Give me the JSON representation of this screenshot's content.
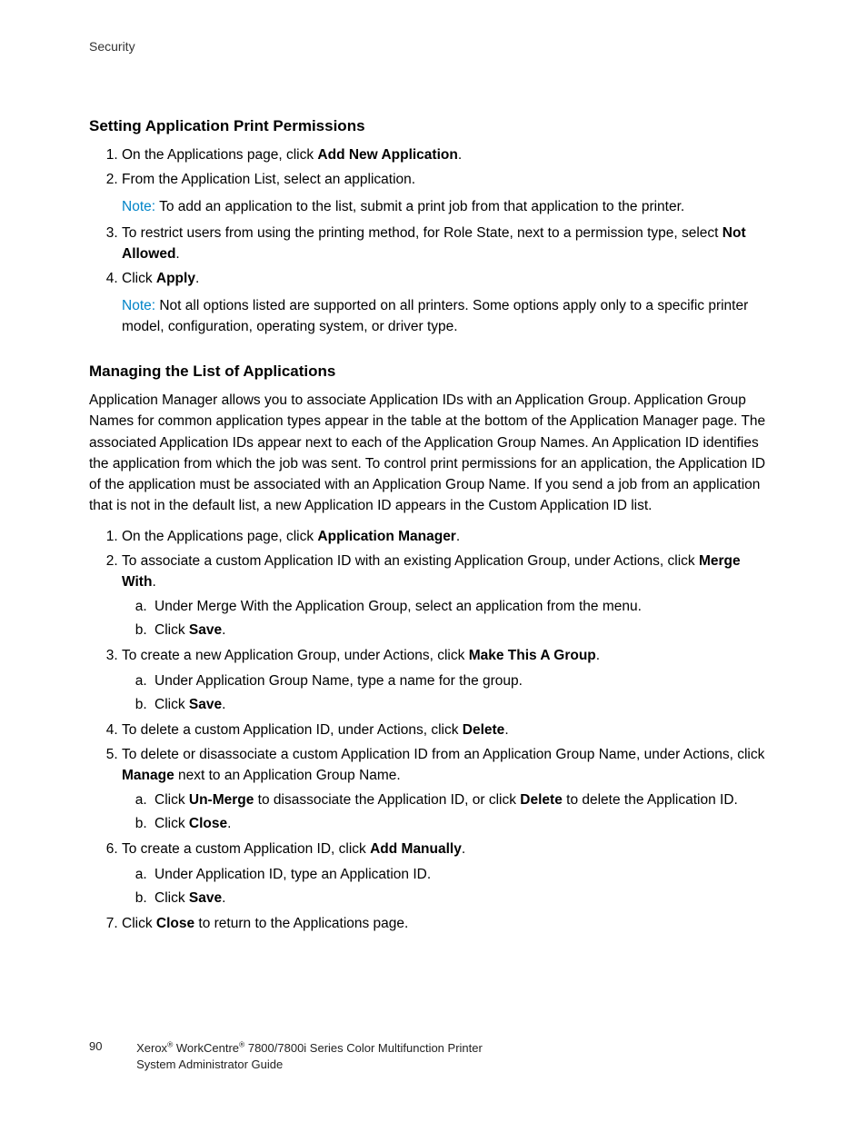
{
  "header": "Security",
  "section1": {
    "title": "Setting Application Print Permissions",
    "item1_pre": "On the Applications page, click ",
    "item1_bold": "Add New Application",
    "item1_post": ".",
    "item2": "From the Application List, select an application.",
    "note1_label": "Note: ",
    "note1_text": "To add an application to the list, submit a print job from that application to the printer.",
    "item3_pre": "To restrict users from using the printing method, for Role State, next to a permission type, select ",
    "item3_bold": "Not Allowed",
    "item3_post": ".",
    "item4_pre": "Click ",
    "item4_bold": "Apply",
    "item4_post": ".",
    "note2_label": "Note: ",
    "note2_text": "Not all options listed are supported on all printers. Some options apply only to a specific printer model, configuration, operating system, or driver type."
  },
  "section2": {
    "title": "Managing the List of Applications",
    "intro": "Application Manager allows you to associate Application IDs with an Application Group. Application Group Names for common application types appear in the table at the bottom of the Application Manager page. The associated Application IDs appear next to each of the Application Group Names. An Application ID identifies the application from which the job was sent. To control print permissions for an application, the Application ID of the application must be associated with an Application Group Name. If you send a job from an application that is not in the default list, a new Application ID appears in the Custom Application ID list.",
    "i1_pre": "On the Applications page, click ",
    "i1_bold": "Application Manager",
    "i1_post": ".",
    "i2_pre": "To associate a custom Application ID with an existing Application Group, under Actions, click ",
    "i2_bold": "Merge With",
    "i2_post": ".",
    "i2a": "Under Merge With the Application Group, select an application from the menu.",
    "i2b_pre": "Click ",
    "i2b_bold": "Save",
    "i2b_post": ".",
    "i3_pre": "To create a new Application Group, under Actions, click ",
    "i3_bold": "Make This A Group",
    "i3_post": ".",
    "i3a": "Under Application Group Name, type a name for the group.",
    "i3b_pre": "Click ",
    "i3b_bold": "Save",
    "i3b_post": ".",
    "i4_pre": "To delete a custom Application ID, under Actions, click ",
    "i4_bold": "Delete",
    "i4_post": ".",
    "i5_pre": "To delete or disassociate a custom Application ID from an Application Group Name, under Actions, click ",
    "i5_bold": "Manage",
    "i5_post": " next to an Application Group Name.",
    "i5a_pre": "Click ",
    "i5a_bold1": "Un-Merge",
    "i5a_mid": " to disassociate the Application ID, or click ",
    "i5a_bold2": "Delete",
    "i5a_post": " to delete the Application ID.",
    "i5b_pre": "Click ",
    "i5b_bold": "Close",
    "i5b_post": ".",
    "i6_pre": "To create a custom Application ID, click ",
    "i6_bold": "Add Manually",
    "i6_post": ".",
    "i6a": "Under Application ID, type an Application ID.",
    "i6b_pre": "Click ",
    "i6b_bold": "Save",
    "i6b_post": ".",
    "i7_pre": "Click ",
    "i7_bold": "Close",
    "i7_post": " to return to the Applications page."
  },
  "footer": {
    "page": "90",
    "l1a": "Xerox",
    "l1b": " WorkCentre",
    "l1c": " 7800/7800i Series Color Multifunction Printer",
    "l2": "System Administrator Guide"
  }
}
